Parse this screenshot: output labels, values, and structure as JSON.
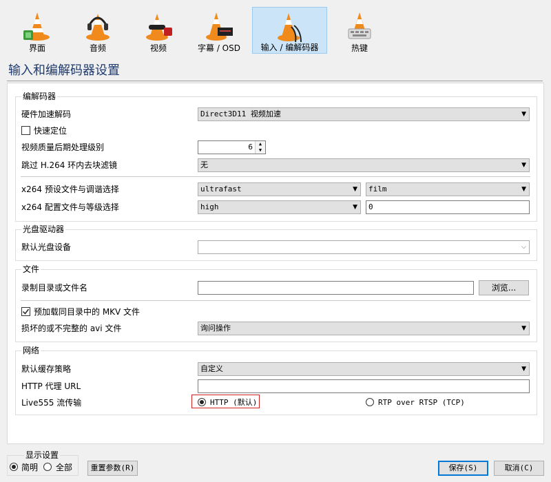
{
  "toolbar": {
    "tabs": [
      {
        "label": "界面"
      },
      {
        "label": "音频"
      },
      {
        "label": "视频"
      },
      {
        "label": "字幕 / OSD"
      },
      {
        "label": "输入 / 编解码器"
      },
      {
        "label": "热键"
      }
    ],
    "selected_index": 4
  },
  "page_title": "输入和编解码器设置",
  "codecs": {
    "title": "编解码器",
    "hw_decoding": {
      "label": "硬件加速解码",
      "value": "Direct3D11 视频加速"
    },
    "fast_seek": {
      "label": "快速定位",
      "checked": false
    },
    "pp_quality": {
      "label": "视频质量后期处理级别",
      "value": "6"
    },
    "skip_h264": {
      "label": "跳过 H.264 环内去块滤镜",
      "value": "无"
    },
    "x264_preset": {
      "label": "x264 预设文件与调谐选择",
      "preset": "ultrafast",
      "tune": "film"
    },
    "x264_profile": {
      "label": "x264 配置文件与等级选择",
      "profile": "high",
      "level": "0"
    }
  },
  "optical": {
    "title": "光盘驱动器",
    "default_device": {
      "label": "默认光盘设备",
      "value": ""
    }
  },
  "files": {
    "title": "文件",
    "record_dir": {
      "label": "录制目录或文件名",
      "value": "",
      "browse": "浏览..."
    },
    "preload_mkv": {
      "label": "预加载同目录中的 MKV 文件",
      "checked": true
    },
    "damaged_avi": {
      "label": "损坏的或不完整的 avi 文件",
      "value": "询问操作"
    }
  },
  "network": {
    "title": "网络",
    "caching": {
      "label": "默认缓存策略",
      "value": "自定义"
    },
    "http_proxy": {
      "label": "HTTP 代理 URL",
      "value": ""
    },
    "live555": {
      "label": "Live555 流传输",
      "opt_http": "HTTP (默认)",
      "opt_rtsp": "RTP over RTSP (TCP)",
      "selected": "HTTP"
    }
  },
  "footer": {
    "show_settings": "显示设置",
    "simple": "简明",
    "all": "全部",
    "selected": "简明",
    "reset": "重置参数(R)",
    "save": "保存(S)",
    "cancel": "取消(C)"
  },
  "colors": {
    "selected_tab_bg": "#cce4f7",
    "title_color": "#1e3a6e",
    "highlight_border": "#d02020",
    "cone_orange": "#f08a1c"
  }
}
